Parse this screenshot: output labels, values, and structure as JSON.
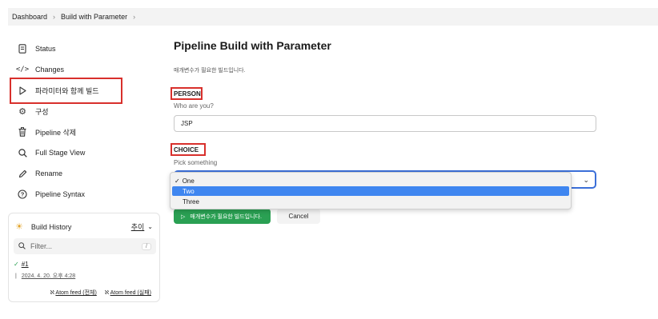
{
  "breadcrumb": {
    "items": [
      "Dashboard",
      "Build with Parameter"
    ]
  },
  "sidebar": {
    "items": [
      {
        "label": "Status",
        "icon": "document-icon"
      },
      {
        "label": "Changes",
        "icon": "code-icon"
      },
      {
        "label": "파라미터와 함께 빌드",
        "icon": "play-icon"
      },
      {
        "label": "구성",
        "icon": "gear-icon"
      },
      {
        "label": "Pipeline 삭제",
        "icon": "trash-icon"
      },
      {
        "label": "Full Stage View",
        "icon": "search-icon"
      },
      {
        "label": "Rename",
        "icon": "pencil-icon"
      },
      {
        "label": "Pipeline Syntax",
        "icon": "help-icon"
      }
    ]
  },
  "history": {
    "title": "Build History",
    "trend": "추이",
    "filter_placeholder": "Filter...",
    "filter_shortcut": "/",
    "build_number": "#1",
    "build_date": "2024. 4. 20. 오후 4:28",
    "feed_all": "Atom feed (전체)",
    "feed_fail": "Atom feed (실패)"
  },
  "main": {
    "title": "Pipeline Build with Parameter",
    "description": "매개변수가 필요한 빌드입니다.",
    "person": {
      "name": "PERSON",
      "desc": "Who are you?",
      "value": "JSP"
    },
    "choice": {
      "name": "CHOICE",
      "desc": "Pick something",
      "options": [
        "One",
        "Two",
        "Three"
      ],
      "checked": "One",
      "highlighted": "Two"
    },
    "build_button": "매개변수가 필요한 빌드입니다.",
    "cancel_button": "Cancel"
  },
  "colors": {
    "highlight_box": "#d8302c",
    "build_green": "#2aa053",
    "select_blue": "#3f86f0",
    "focus_border": "#3b6fd8"
  }
}
